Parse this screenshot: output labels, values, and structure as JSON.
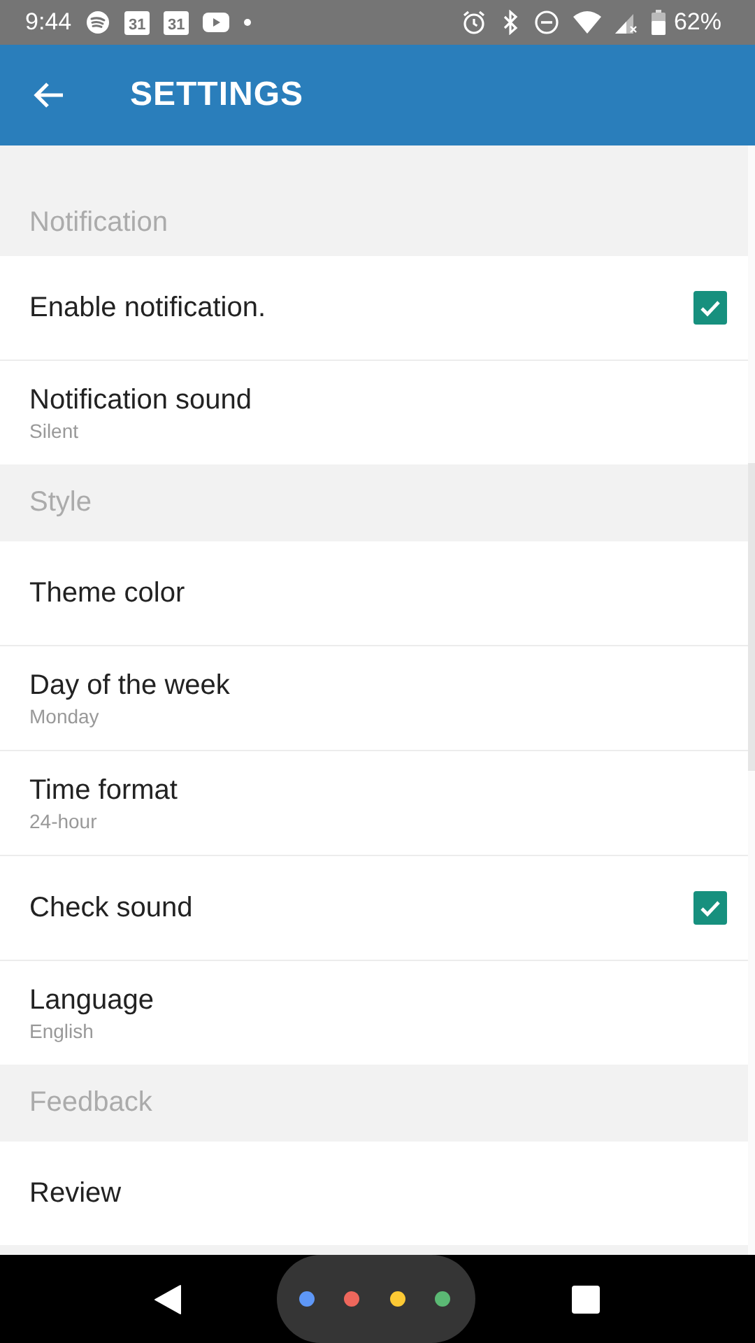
{
  "status_bar": {
    "time": "9:44",
    "calendar_day": "31",
    "calendar_day_2": "31",
    "battery": "62%"
  },
  "app_bar": {
    "title": "SETTINGS"
  },
  "sections": [
    {
      "title": "Notification",
      "items": [
        {
          "kind": "checkbox",
          "title": "Enable notification.",
          "checked": true
        },
        {
          "kind": "value",
          "title": "Notification sound",
          "value": "Silent"
        }
      ]
    },
    {
      "title": "Style",
      "items": [
        {
          "kind": "plain",
          "title": "Theme color"
        },
        {
          "kind": "value",
          "title": "Day of the week",
          "value": "Monday"
        },
        {
          "kind": "value",
          "title": "Time format",
          "value": "24-hour"
        },
        {
          "kind": "checkbox",
          "title": "Check sound",
          "checked": true
        },
        {
          "kind": "value",
          "title": "Language",
          "value": "English"
        }
      ]
    },
    {
      "title": "Feedback",
      "items": [
        {
          "kind": "plain",
          "title": "Review"
        }
      ]
    }
  ],
  "assistant_dots": [
    {
      "color": "#5e97f6"
    },
    {
      "color": "#ee675c"
    },
    {
      "color": "#fcc934"
    },
    {
      "color": "#5bb974"
    }
  ]
}
